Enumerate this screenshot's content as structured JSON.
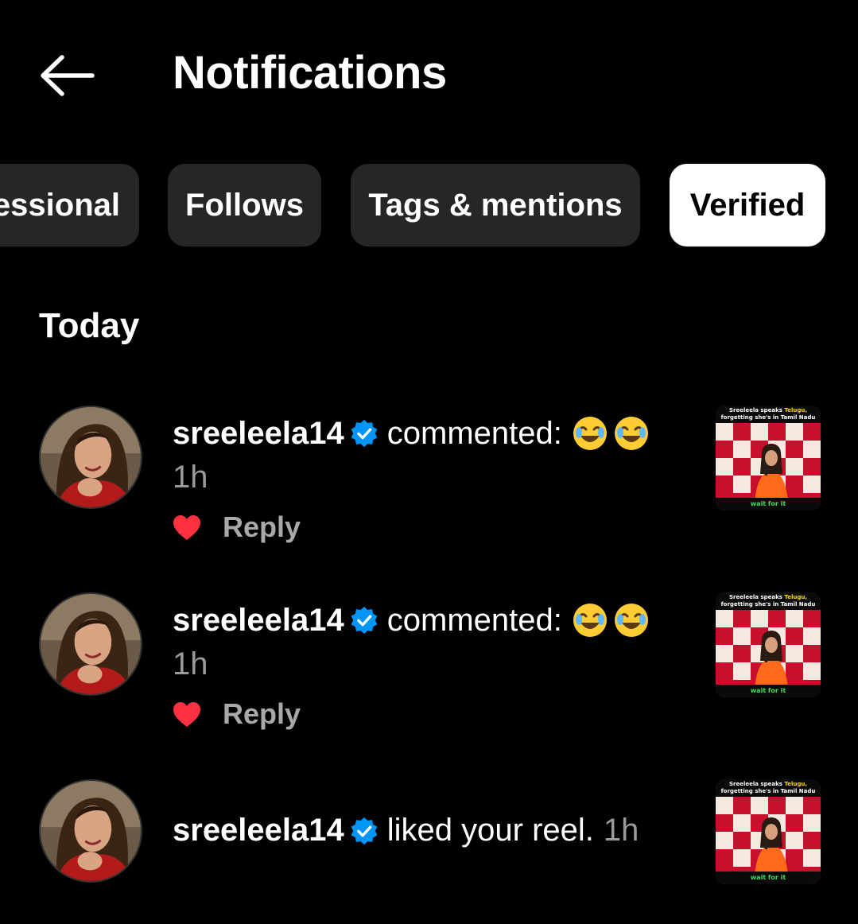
{
  "header": {
    "title": "Notifications",
    "back_icon": "arrow-left-icon"
  },
  "filters": [
    {
      "label": "Professional",
      "visible_label": "essional",
      "active": false
    },
    {
      "label": "Follows",
      "visible_label": "Follows",
      "active": false
    },
    {
      "label": "Tags & mentions",
      "visible_label": "Tags & mentions",
      "active": false
    },
    {
      "label": "Verified",
      "visible_label": "Verified",
      "active": true
    }
  ],
  "section": {
    "heading": "Today"
  },
  "notifications": [
    {
      "username": "sreeleela14",
      "action": "commented:",
      "emoji": "😂😂",
      "time": "1h",
      "reply_label": "Reply",
      "liked": true
    },
    {
      "username": "sreeleela14",
      "action": "commented:",
      "emoji": "😂😂",
      "time": "1h",
      "reply_label": "Reply",
      "liked": true
    },
    {
      "username": "sreeleela14",
      "action": "liked your reel.",
      "time": "1h"
    }
  ],
  "thumbnail": {
    "caption_top_a": "Sreeleela speaks ",
    "caption_top_hl": "Telugu,",
    "caption_top_b": "forgetting she's in Tamil Nadu",
    "caption_bottom": "wait for it"
  },
  "colors": {
    "background": "#000000",
    "chip": "#262626",
    "chip_active": "#ffffff",
    "verified": "#0095f6",
    "heart": "#ff3040",
    "muted": "#9a9a9a"
  }
}
